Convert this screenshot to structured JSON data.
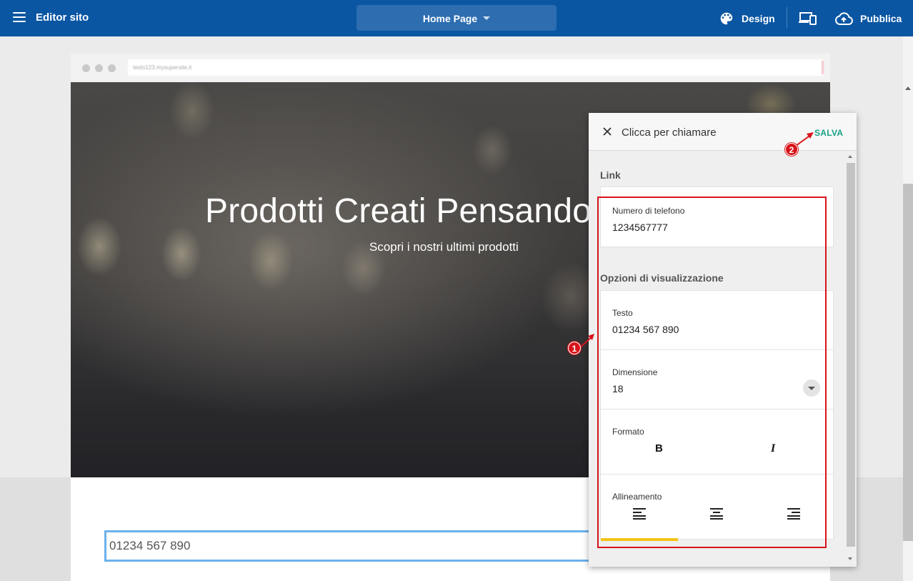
{
  "topbar": {
    "app_title": "Editor sito",
    "page_selector": "Home Page",
    "design_label": "Design",
    "publish_label": "Pubblica"
  },
  "browser": {
    "url": "testo123.mysupersite.it"
  },
  "hero": {
    "title": "Prodotti Creati Pensando",
    "subtitle": "Scopri i nostri ultimi prodotti"
  },
  "site": {
    "phone_button_text": "01234 567 890"
  },
  "panel": {
    "title": "Clicca per chiamare",
    "save_label": "SALVA",
    "link_section": "Link",
    "phone_label": "Numero di telefono",
    "phone_value": "1234567777",
    "display_section": "Opzioni di visualizzazione",
    "text_label": "Testo",
    "text_value": "01234 567 890",
    "size_label": "Dimensione",
    "size_value": "18",
    "format_label": "Formato",
    "bold_label": "B",
    "italic_label": "I",
    "align_label": "Allineamento",
    "align_selected": "left"
  },
  "annotations": {
    "badge_1": "1",
    "badge_2": "2",
    "color": "#d7141a"
  },
  "colors": {
    "topbar": "#0a56a3",
    "save": "#17a085",
    "align_indicator": "#f4c316",
    "selection_outline": "#6cb1ec"
  }
}
